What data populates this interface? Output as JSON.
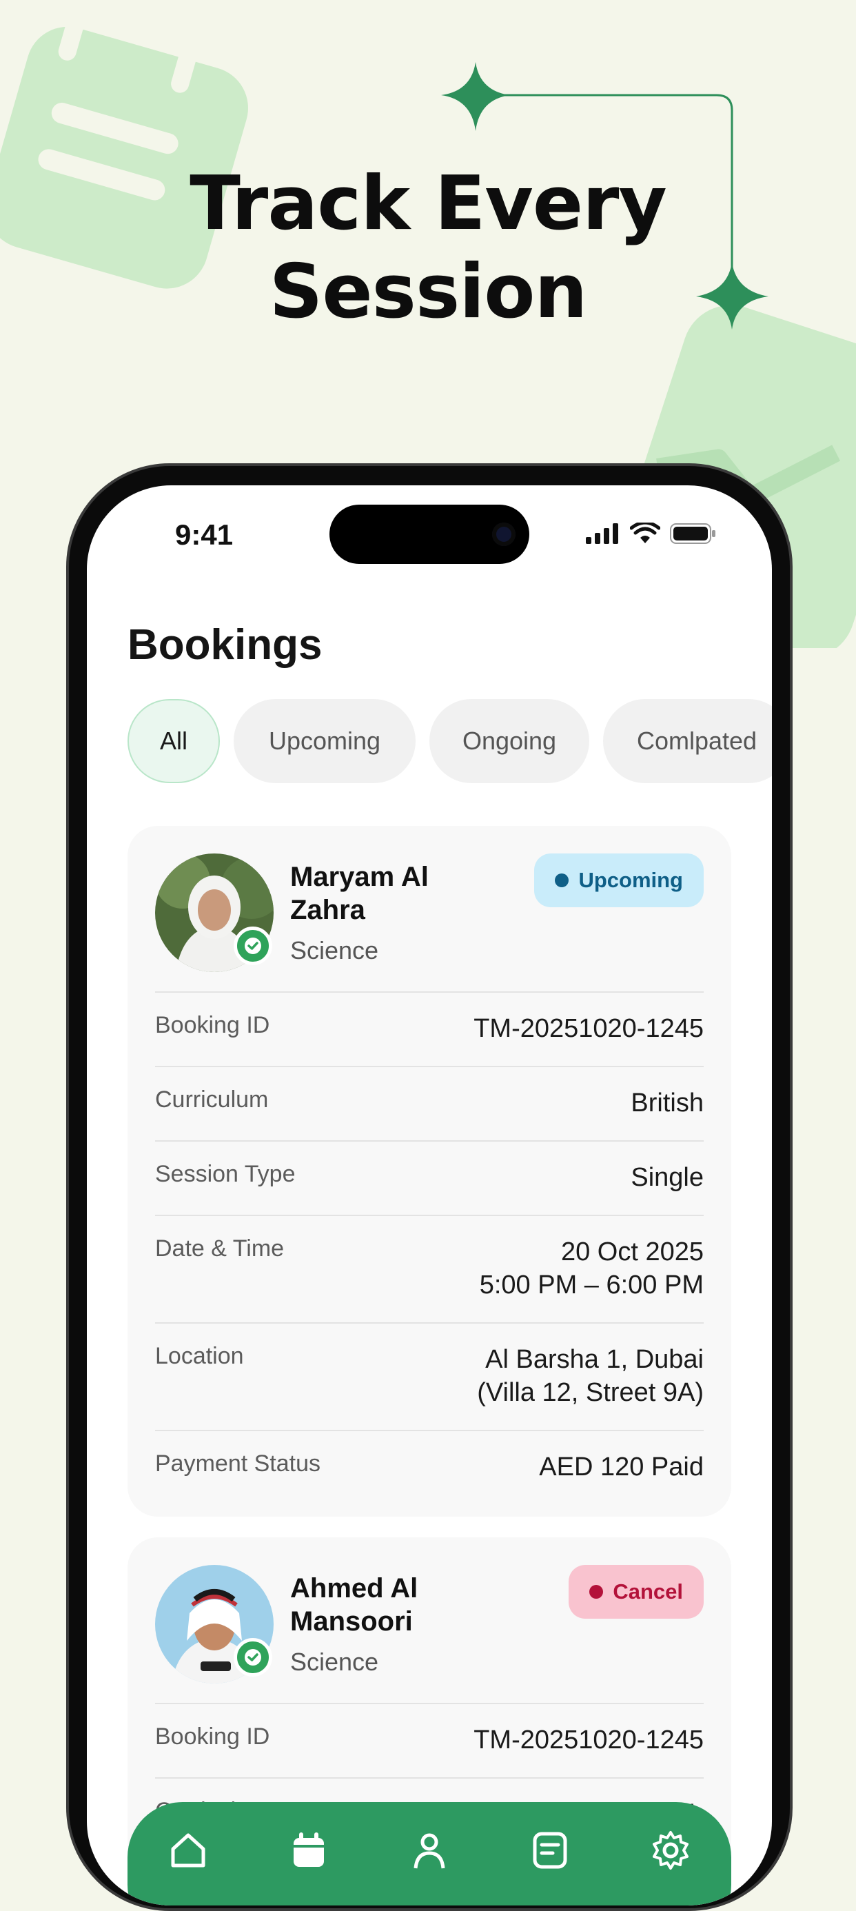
{
  "hero": {
    "title_line1": "Track Every",
    "title_line2": "Session"
  },
  "status_bar": {
    "time": "9:41"
  },
  "page": {
    "title": "Bookings"
  },
  "tabs": [
    {
      "label": "All",
      "active": true
    },
    {
      "label": "Upcoming",
      "active": false
    },
    {
      "label": "Ongoing",
      "active": false
    },
    {
      "label": "Comlpated",
      "active": false
    }
  ],
  "bookings": [
    {
      "tutor_name": "Maryam Al Zahra",
      "subject": "Science",
      "status": "Upcoming",
      "rows": [
        {
          "label": "Booking ID",
          "value": "TM-20251020-1245"
        },
        {
          "label": "Curriculum",
          "value": "British"
        },
        {
          "label": "Session Type",
          "value": "Single"
        },
        {
          "label": "Date & Time",
          "value_line1": "20 Oct 2025",
          "value_line2": "5:00 PM – 6:00 PM"
        },
        {
          "label": "Location",
          "value_line1": "Al Barsha 1, Dubai",
          "value_line2": "(Villa 12, Street 9A)"
        },
        {
          "label": "Payment Status",
          "value": "AED 120 Paid"
        }
      ]
    },
    {
      "tutor_name": "Ahmed Al Mansoori",
      "subject": "Science",
      "status": "Cancel",
      "rows": [
        {
          "label": "Booking ID",
          "value": "TM-20251020-1245"
        },
        {
          "label": "Curriculum",
          "value": "British"
        }
      ]
    }
  ],
  "nav": {
    "items": [
      "home-icon",
      "calendar-icon",
      "profile-icon",
      "document-icon",
      "settings-icon"
    ],
    "active": "calendar-icon"
  },
  "colors": {
    "background": "#f4f6ea",
    "accent_green": "#2d9a61",
    "decor_green": "#cdebc9",
    "upcoming_badge": "#c9ecfa",
    "cancel_badge": "#f9c3cf"
  }
}
